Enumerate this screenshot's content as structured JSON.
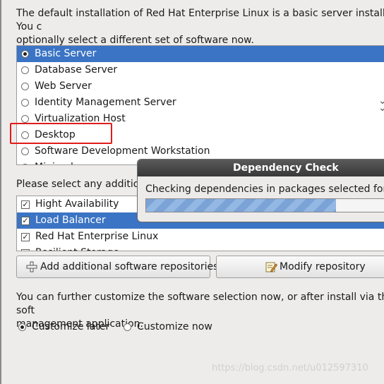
{
  "intro_text": "The default installation of Red Hat Enterprise Linux is a basic server install. You c\noptionally select a different set of software now.",
  "environments": [
    {
      "label": "Basic Server",
      "selected": true
    },
    {
      "label": "Database Server",
      "selected": false
    },
    {
      "label": "Web Server",
      "selected": false
    },
    {
      "label": "Identity Management Server",
      "selected": false
    },
    {
      "label": "Virtualization Host",
      "selected": false
    },
    {
      "label": "Desktop",
      "selected": false
    },
    {
      "label": "Software Development Workstation",
      "selected": false
    },
    {
      "label": "Minimal",
      "selected": false
    }
  ],
  "addon_prompt": "Please select any additional",
  "addons": [
    {
      "label": "Hight Availability",
      "checked": true
    },
    {
      "label": "Load Balancer",
      "checked": true
    },
    {
      "label": "Red Hat Enterprise Linux",
      "checked": true
    },
    {
      "label": "Resilient Storage",
      "checked": false
    }
  ],
  "buttons": {
    "add_repo": "Add additional software repositories",
    "modify_repo": "Modify repository"
  },
  "outro_text": "You can further customize the software selection now, or after install via the soft\nmanagement application.",
  "customize": {
    "later": "Customize later",
    "now": "Customize now",
    "selected": "later"
  },
  "dialog": {
    "title": "Dependency Check",
    "message": "Checking dependencies in packages selected for inst",
    "progress": 0.75
  },
  "watermark": "https://blog.csdn.net/u012597310",
  "colors": {
    "selection": "#3b74c4",
    "highlight_box": "#e01b1b"
  }
}
